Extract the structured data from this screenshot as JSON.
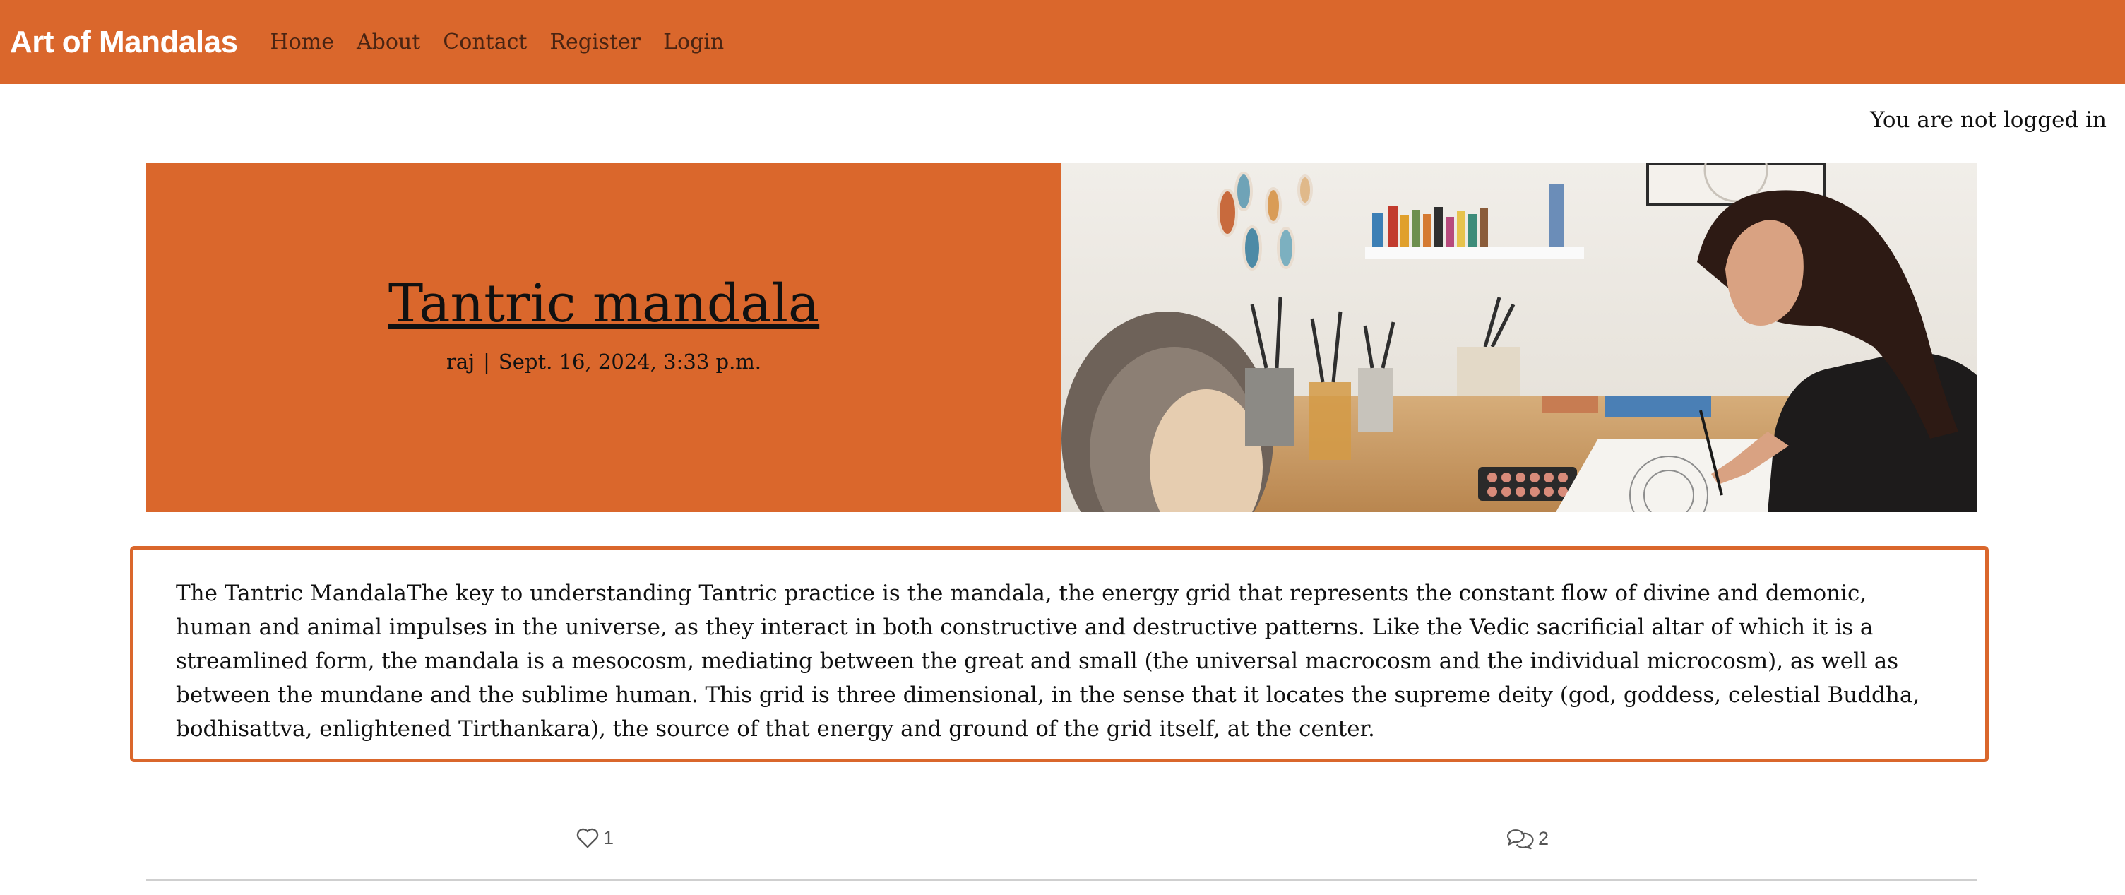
{
  "nav": {
    "brand": "Art of Mandalas",
    "links": [
      "Home",
      "About",
      "Contact",
      "Register",
      "Login"
    ]
  },
  "status": {
    "login_text": "You are not logged in"
  },
  "post": {
    "title": "Tantric mandala",
    "author": "raj",
    "separator": "|",
    "date": "Sept. 16, 2024, 3:33 p.m.",
    "image_icon": "artist-painting-mandala-photo",
    "content": "The Tantric MandalaThe key to understanding Tantric practice is the mandala, the energy grid that represents the constant flow of divine and demonic, human and animal impulses in the universe, as they interact in both constructive and destructive patterns. Like the Vedic sacrificial altar of which it is a streamlined form, the mandala is a mesocosm, mediating between the great and small (the universal macrocosm and the individual microcosm), as well as between the mundane and the sublime human. This grid is three dimensional, in the sense that it locates the supreme deity (god, goddess, celestial Buddha, bodhisattva, enlightened Tirthankara), the source of that energy and ground of the grid itself, at the center."
  },
  "stats": {
    "likes": "1",
    "like_icon": "heart-icon",
    "comments": "2",
    "comment_icon": "comments-icon"
  },
  "colors": {
    "accent": "#da672c",
    "divider": "#cfcfcf"
  }
}
